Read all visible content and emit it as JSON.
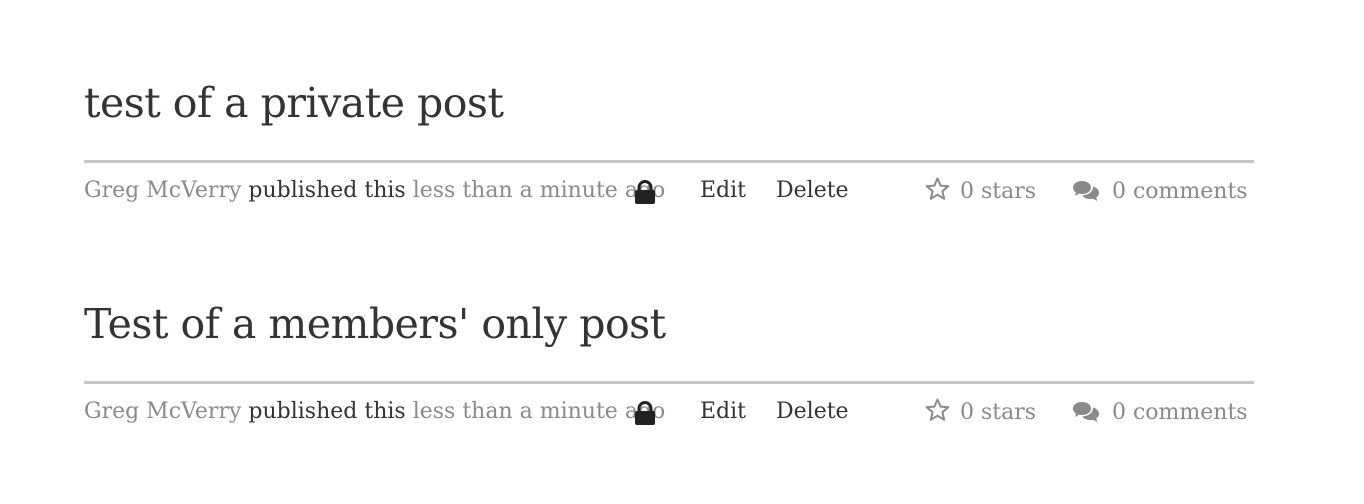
{
  "posts": [
    {
      "title": "test of a private post",
      "author": "Greg McVerry",
      "published_label": "published this",
      "time": "less than a minute ago",
      "visibility_icon": "lock-icon",
      "edit_label": "Edit",
      "delete_label": "Delete",
      "stars": "0 stars",
      "comments": "0 comments"
    },
    {
      "title": "Test of a members' only post",
      "author": "Greg McVerry",
      "published_label": "published this",
      "time": "less than a minute ago",
      "visibility_icon": "lock-icon",
      "edit_label": "Edit",
      "delete_label": "Delete",
      "stars": "0 stars",
      "comments": "0 comments"
    }
  ],
  "colors": {
    "title": "#333333",
    "muted": "#8a8a8a",
    "rule": "#c6c6c6"
  }
}
